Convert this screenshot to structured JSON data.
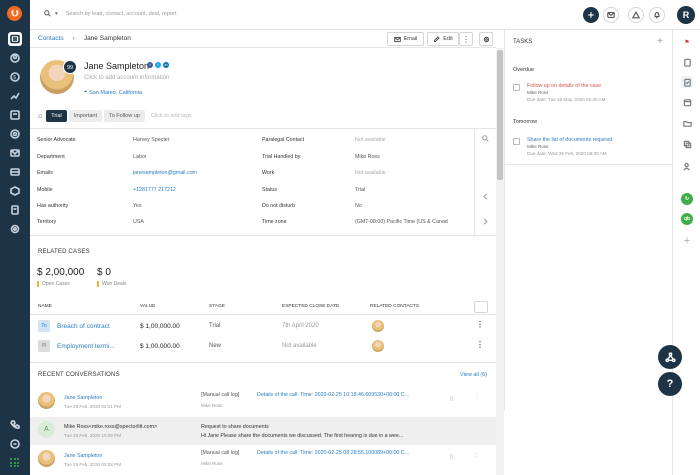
{
  "app": {
    "logo_icon": "freshsales-logo-icon",
    "brand_color": "#1c3445",
    "accent_color": "#2a7ec3",
    "user_initial": "R"
  },
  "nav": {
    "items": [
      "contacts-icon",
      "accounts-icon",
      "deals-icon",
      "reports-icon",
      "phone-icon",
      "sequences-icon",
      "campaigns-icon",
      "inbox-icon",
      "products-icon",
      "documents-icon",
      "settings-icon"
    ],
    "bottom": [
      "phone-call-icon",
      "chat-icon",
      "apps-grid-icon"
    ]
  },
  "topbar": {
    "search_placeholder": "Search by lead, contact, account, deal, report"
  },
  "breadcrumb": {
    "parent": "Contacts",
    "separator": "›",
    "current": "Jane Sampleton",
    "email_label": "Email",
    "edit_label": "Edit"
  },
  "contact": {
    "name": "Jane Sampleton",
    "score": "99",
    "account_placeholder": "Click to add account information",
    "location": "San Mateo, California",
    "tags": [
      "Trial",
      "Important",
      "To Follow up"
    ],
    "active_tag": "Trial",
    "add_tags": "Click to add tags"
  },
  "fields": {
    "left": [
      {
        "label": "Senior Advocate",
        "value": "Harvey Specter",
        "kind": "text"
      },
      {
        "label": "Department",
        "value": "Labor",
        "kind": "text"
      },
      {
        "label": "Emails",
        "value": "janesampleton@gmail.com",
        "kind": "link"
      },
      {
        "label": "Mobile",
        "value": "+1281777 217212",
        "kind": "link"
      },
      {
        "label": "Has authority",
        "value": "Yes",
        "kind": "text"
      },
      {
        "label": "Territory",
        "value": "USA",
        "kind": "text"
      }
    ],
    "right": [
      {
        "label": "Paralegal Contact",
        "value": "Not available",
        "kind": "na"
      },
      {
        "label": "Trial Handled by",
        "value": "Mike Ross",
        "kind": "text"
      },
      {
        "label": "Work",
        "value": "Not available",
        "kind": "na"
      },
      {
        "label": "Status",
        "value": "Trial",
        "kind": "text"
      },
      {
        "label": "Do not disturb",
        "value": "No",
        "kind": "text"
      },
      {
        "label": "Time zone",
        "value": "(GMT-08:00) Pacific Time (US & Canad",
        "kind": "text"
      }
    ]
  },
  "related_cases": {
    "title": "RELATED CASES",
    "open_value": "$ 2,00,000",
    "open_label": "Open Cases",
    "won_value": "$ 0",
    "won_label": "Won Deals",
    "columns": [
      "NAME",
      "VALUE",
      "STAGE",
      "EXPECTED CLOSE DATE",
      "RELATED CONTACTS"
    ],
    "rows": [
      {
        "badge": "To",
        "name": "Breach of contract",
        "value": "$ 1,00,000.00",
        "stage": "Trial",
        "close": "7th April 2020"
      },
      {
        "badge": "PI",
        "name": "Employment termi...",
        "value": "$ 1,00,000.00",
        "stage": "New",
        "close": "Not available"
      }
    ]
  },
  "conversations": {
    "title": "RECENT CONVERSATIONS",
    "view_all": "View all (6)",
    "items": [
      {
        "who": "Jane Sampleton",
        "time": "Tue 25 Feb, 2020 04:21 PM",
        "kind": "[Manual call log]",
        "subject": "Details of the call: Time: 2020-02-25 10:18:46.609530+00:00 C...",
        "by": "Mike Ross"
      },
      {
        "who": "Mike Ross<mike.ross@spectorlitt.com>",
        "time": "Tue 25 Feb, 2020 10:09 PM",
        "kind": "Request to share documents",
        "subject": "Hi Jane Please share the documents we discussed. The first hearing is due in a wee...",
        "by": ""
      },
      {
        "who": "Jane Sampleton",
        "time": "Tue 25 Feb, 2020 03:28 PM",
        "kind": "[Manual call log]",
        "subject": "Details of the call: Time: 2020-02-25 08:28:55.100089+00:00 C...",
        "by": "Mike Ross"
      }
    ]
  },
  "tasks": {
    "title": "TASKS",
    "groups": [
      {
        "label": "Overdue",
        "task": "Follow up on details of the case",
        "owner": "Mike Ross",
        "due": "Due date: Tue 25 May, 2020 05:30 AM",
        "color": "#d9534f"
      },
      {
        "label": "Tomorrow",
        "task": "Share the list of documents required",
        "owner": "Mike Ross",
        "due": "Due date: Wed 26 Feb, 2020 08:00 AM",
        "color": "#2a7ec3"
      }
    ]
  },
  "right_rail": [
    "flag-icon",
    "clipboard-icon",
    "task-list-icon",
    "calendar-icon",
    "folder-icon",
    "copy-icon",
    "people-icon",
    "refresh-app-icon",
    "quickbooks-icon",
    "add-app-icon"
  ],
  "fabs": [
    "share-node-icon",
    "help-icon"
  ]
}
